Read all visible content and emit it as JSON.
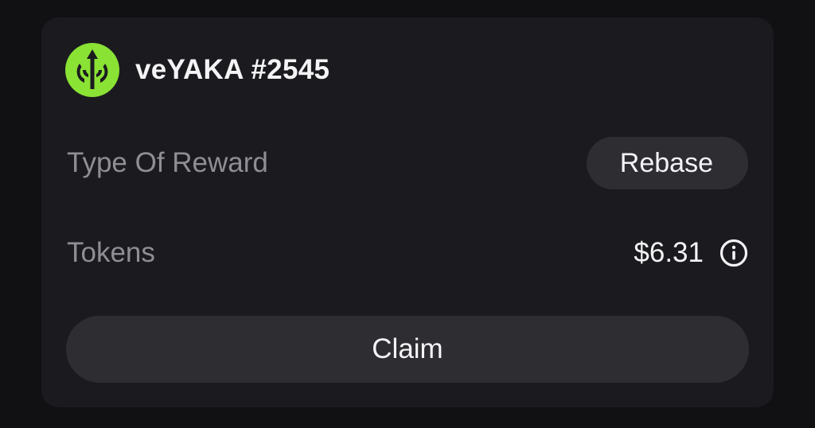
{
  "nft": {
    "title": "veYAKA #2545",
    "logo_icon": "yaka-trident-logo",
    "logo_color": "#8ae234"
  },
  "reward": {
    "label": "Type Of Reward",
    "type": "Rebase"
  },
  "tokens": {
    "label": "Tokens",
    "value": "$6.31",
    "info_icon": "info-icon"
  },
  "actions": {
    "claim_label": "Claim"
  }
}
